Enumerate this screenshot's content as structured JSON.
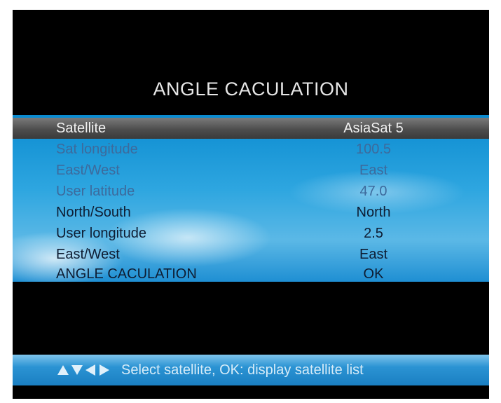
{
  "screen": {
    "title": "ANGLE CACULATION"
  },
  "menu": {
    "rows": [
      {
        "label": "Satellite",
        "value": "AsiaSat 5"
      },
      {
        "label": "Sat longitude",
        "value": "100.5"
      },
      {
        "label": "East/West",
        "value": "East"
      },
      {
        "label": "User latitude",
        "value": "47.0"
      },
      {
        "label": "North/South",
        "value": "North"
      },
      {
        "label": "User longitude",
        "value": "2.5"
      },
      {
        "label": "East/West",
        "value": "East"
      },
      {
        "label": "ANGLE CACULATION",
        "value": "OK"
      }
    ]
  },
  "hint": {
    "text": "Select satellite, OK: display satellite list",
    "icons": [
      "up-arrow-icon",
      "down-arrow-icon",
      "left-arrow-icon",
      "right-arrow-icon"
    ]
  },
  "colors": {
    "background": "#000000",
    "panel_blue": "#2ea6e0",
    "selected_row": "#4e4e4e",
    "title_text": "#e6e6e6"
  }
}
